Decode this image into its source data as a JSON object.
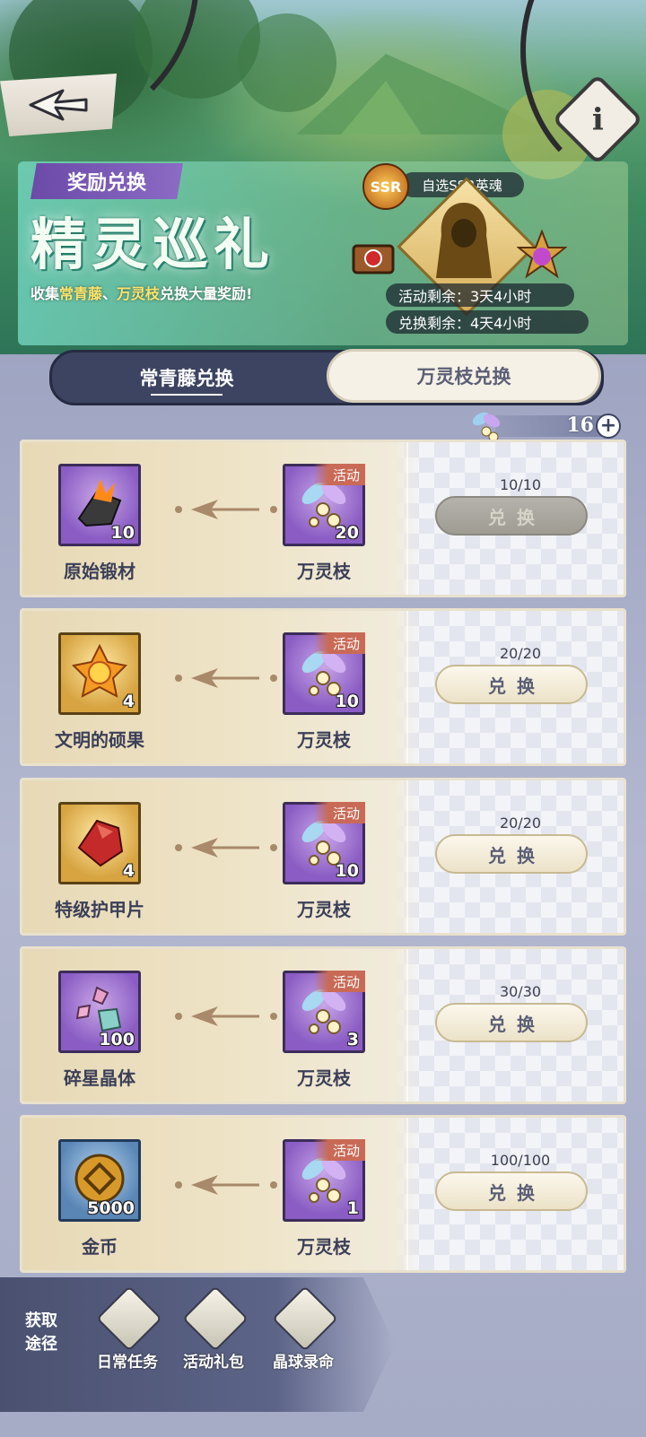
{
  "banner": {
    "tag": "奖励兑换",
    "title": "精灵巡礼",
    "subtitle_pre": "收集",
    "subtitle_hl1": "常青藤",
    "subtitle_mid": "、",
    "subtitle_hl2": "万灵枝",
    "subtitle_post": "兑换大量奖励!",
    "ssr_badge": "SSR",
    "ssr_label": "自选SSR英魂",
    "activity_remaining": "活动剩余：3天4小时",
    "exchange_remaining": "兑换剩余：4天4小时"
  },
  "tabs": {
    "active": "常青藤兑换",
    "inactive": "万灵枝兑换"
  },
  "currency": {
    "value": "16",
    "plus": "+"
  },
  "rows": [
    {
      "reward_name": "原始锻材",
      "reward_count": "10",
      "cost_name": "万灵枝",
      "cost_count": "20",
      "cost_tag": "活动",
      "limit": "10/10",
      "button": "兑换",
      "disabled": true
    },
    {
      "reward_name": "文明的硕果",
      "reward_count": "4",
      "cost_name": "万灵枝",
      "cost_count": "10",
      "cost_tag": "活动",
      "limit": "20/20",
      "button": "兑换",
      "disabled": false
    },
    {
      "reward_name": "特级护甲片",
      "reward_count": "4",
      "cost_name": "万灵枝",
      "cost_count": "10",
      "cost_tag": "活动",
      "limit": "20/20",
      "button": "兑换",
      "disabled": false
    },
    {
      "reward_name": "碎星晶体",
      "reward_count": "100",
      "cost_name": "万灵枝",
      "cost_count": "3",
      "cost_tag": "活动",
      "limit": "30/30",
      "button": "兑换",
      "disabled": false
    },
    {
      "reward_name": "金币",
      "reward_count": "5000",
      "cost_name": "万灵枝",
      "cost_count": "1",
      "cost_tag": "活动",
      "limit": "100/100",
      "button": "兑换",
      "disabled": false
    }
  ],
  "sources": {
    "label": "获取途径",
    "items": [
      "日常任务",
      "活动礼包",
      "晶球录命"
    ]
  },
  "info_button": "i",
  "icons": {
    "back": "back-arrow-icon",
    "info": "info-icon",
    "currency": "spirit-branch-icon"
  },
  "colors": {
    "accent_purple": "#6b4aa8",
    "tab_bg": "#3d4462",
    "row_tag": "#c96a56"
  }
}
